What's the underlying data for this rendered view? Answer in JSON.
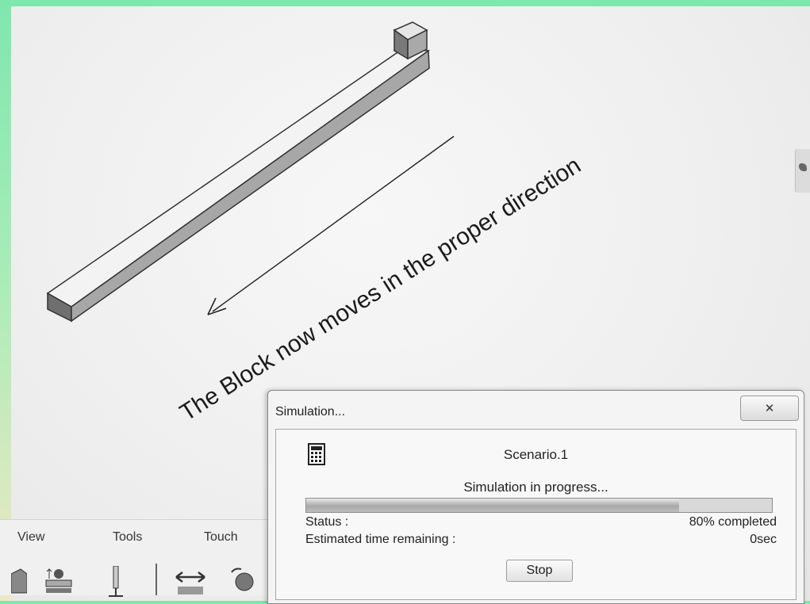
{
  "annotation": {
    "caption": "The Block now moves in the proper direction"
  },
  "toolbar": {
    "menu": [
      {
        "label": "View"
      },
      {
        "label": "Tools"
      },
      {
        "label": "Touch"
      }
    ]
  },
  "dialog": {
    "title": "Simulation...",
    "close_label": "✕",
    "scenario": "Scenario.1",
    "progress_text": "Simulation in progress...",
    "progress_fraction": 0.8,
    "status_label": "Status :",
    "status_value": "80% completed",
    "time_label": "Estimated time remaining :",
    "time_value": "0sec",
    "stop_label": "Stop"
  }
}
